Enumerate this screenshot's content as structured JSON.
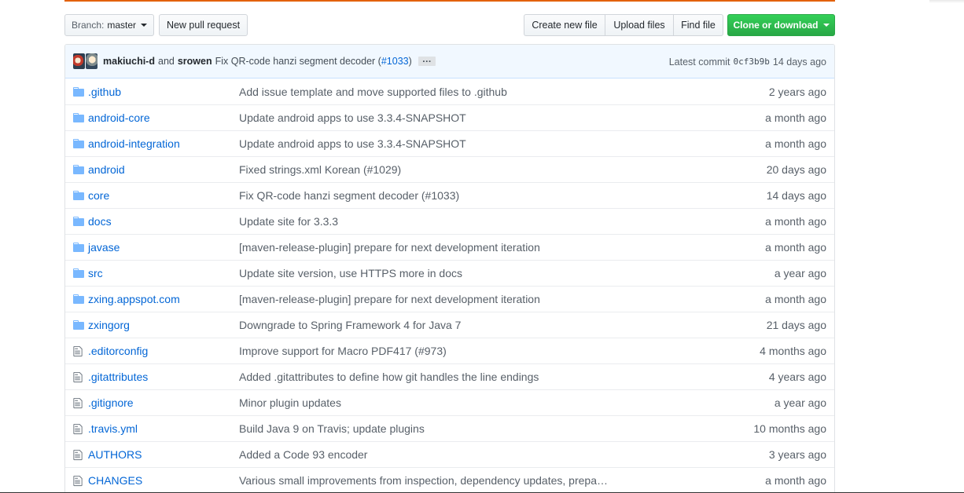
{
  "toolbar": {
    "branch_key": "Branch:",
    "branch_value": "master",
    "new_pull_request": "New pull request",
    "create_new_file": "Create new file",
    "upload_files": "Upload files",
    "find_file": "Find file",
    "clone_or_download": "Clone or download"
  },
  "commit": {
    "author1": "makiuchi-d",
    "and": "and",
    "author2": "srowen",
    "message_prefix": "Fix QR-code hanzi segment decoder (",
    "message_link": "#1033",
    "message_suffix": ")",
    "ellipsis": "…",
    "latest_label": "Latest commit",
    "sha": "0cf3b9b",
    "age": "14 days ago"
  },
  "colors": {
    "link": "#0366d6",
    "clone_green": "#28a745",
    "accent_top": "#e36209"
  },
  "files": [
    {
      "type": "folder",
      "name": ".github",
      "message": "Add issue template and move supported files to .github",
      "age": "2 years ago"
    },
    {
      "type": "folder",
      "name": "android-core",
      "message": "Update android apps to use 3.3.4-SNAPSHOT",
      "age": "a month ago"
    },
    {
      "type": "folder",
      "name": "android-integration",
      "message": "Update android apps to use 3.3.4-SNAPSHOT",
      "age": "a month ago"
    },
    {
      "type": "folder",
      "name": "android",
      "message": "Fixed strings.xml Korean (#1029)",
      "age": "20 days ago"
    },
    {
      "type": "folder",
      "name": "core",
      "message": "Fix QR-code hanzi segment decoder (#1033)",
      "age": "14 days ago"
    },
    {
      "type": "folder",
      "name": "docs",
      "message": "Update site for 3.3.3",
      "age": "a month ago"
    },
    {
      "type": "folder",
      "name": "javase",
      "message": "[maven-release-plugin] prepare for next development iteration",
      "age": "a month ago"
    },
    {
      "type": "folder",
      "name": "src",
      "message": "Update site version, use HTTPS more in docs",
      "age": "a year ago"
    },
    {
      "type": "folder",
      "name": "zxing.appspot.com",
      "message": "[maven-release-plugin] prepare for next development iteration",
      "age": "a month ago"
    },
    {
      "type": "folder",
      "name": "zxingorg",
      "message": "Downgrade to Spring Framework 4 for Java 7",
      "age": "21 days ago"
    },
    {
      "type": "file",
      "name": ".editorconfig",
      "message": "Improve support for Macro PDF417 (#973)",
      "age": "4 months ago"
    },
    {
      "type": "file",
      "name": ".gitattributes",
      "message": "Added .gitattributes to define how git handles the line endings",
      "age": "4 years ago"
    },
    {
      "type": "file",
      "name": ".gitignore",
      "message": "Minor plugin updates",
      "age": "a year ago"
    },
    {
      "type": "file",
      "name": ".travis.yml",
      "message": "Build Java 9 on Travis; update plugins",
      "age": "10 months ago"
    },
    {
      "type": "file",
      "name": "AUTHORS",
      "message": "Added a Code 93 encoder",
      "age": "3 years ago"
    },
    {
      "type": "file",
      "name": "CHANGES",
      "message": "Various small improvements from inspection, dependency updates, prepa…",
      "age": "a month ago"
    }
  ]
}
